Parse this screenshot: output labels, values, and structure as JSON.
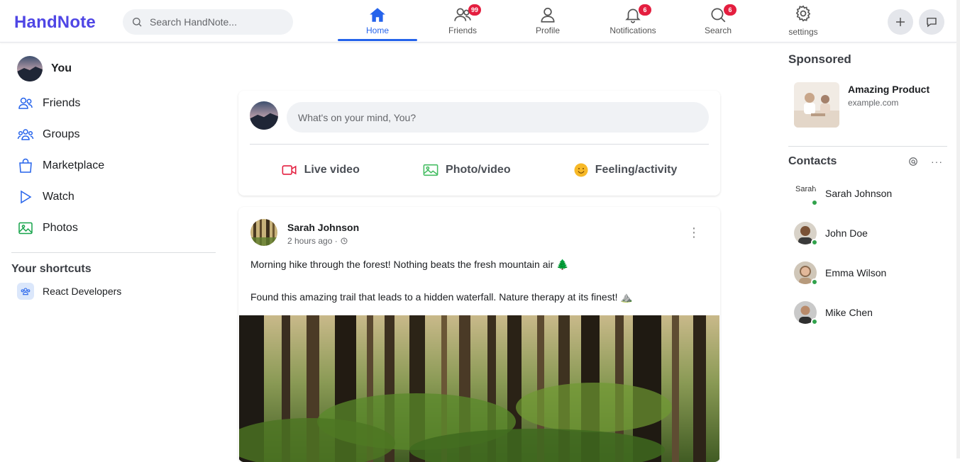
{
  "app": {
    "name": "HandNote"
  },
  "search": {
    "placeholder": "Search HandNote..."
  },
  "nav": [
    {
      "label": "Home",
      "icon": "home-icon",
      "active": true
    },
    {
      "label": "Friends",
      "icon": "friends-icon",
      "badge": "99"
    },
    {
      "label": "Profile",
      "icon": "profile-icon"
    },
    {
      "label": "Notifications",
      "icon": "bell-icon",
      "badge": "6"
    },
    {
      "label": "Search",
      "icon": "search-icon",
      "badge": "6"
    },
    {
      "label": "settings",
      "icon": "gear-icon"
    }
  ],
  "sidebar": {
    "user": "You",
    "items": [
      {
        "label": "Friends",
        "icon": "friends-icon"
      },
      {
        "label": "Groups",
        "icon": "groups-icon"
      },
      {
        "label": "Marketplace",
        "icon": "shopping-bag-icon"
      },
      {
        "label": "Watch",
        "icon": "play-icon"
      },
      {
        "label": "Photos",
        "icon": "image-icon"
      }
    ],
    "shortcuts_title": "Your shortcuts",
    "shortcuts": [
      {
        "label": "React Developers",
        "icon": "group-icon"
      }
    ]
  },
  "composer": {
    "placeholder": "What's on your mind, You?",
    "actions": [
      {
        "label": "Live video",
        "icon": "video-camera-icon",
        "color": "#e41e3f"
      },
      {
        "label": "Photo/video",
        "icon": "image-icon",
        "color": "#45bd62"
      },
      {
        "label": "Feeling/activity",
        "icon": "smiley-icon",
        "color": "#f7b928"
      }
    ]
  },
  "post": {
    "author": "Sarah Johnson",
    "time": "2 hours ago ·",
    "line1": "Morning hike through the forest! Nothing beats the fresh mountain air 🌲",
    "line2": "Found this amazing trail that leads to a hidden waterfall. Nature therapy at its finest! ⛰️"
  },
  "sponsored": {
    "title": "Sponsored",
    "name": "Amazing Product",
    "url": "example.com"
  },
  "contacts": {
    "title": "Contacts",
    "broken_alt": "Sarah",
    "people": [
      "Sarah Johnson",
      "John Doe",
      "Emma Wilson",
      "Mike Chen"
    ]
  },
  "colors": {
    "brand": "#4f46e5",
    "accent": "#2563eb",
    "badge": "#e41e3f",
    "online": "#31a24c"
  }
}
